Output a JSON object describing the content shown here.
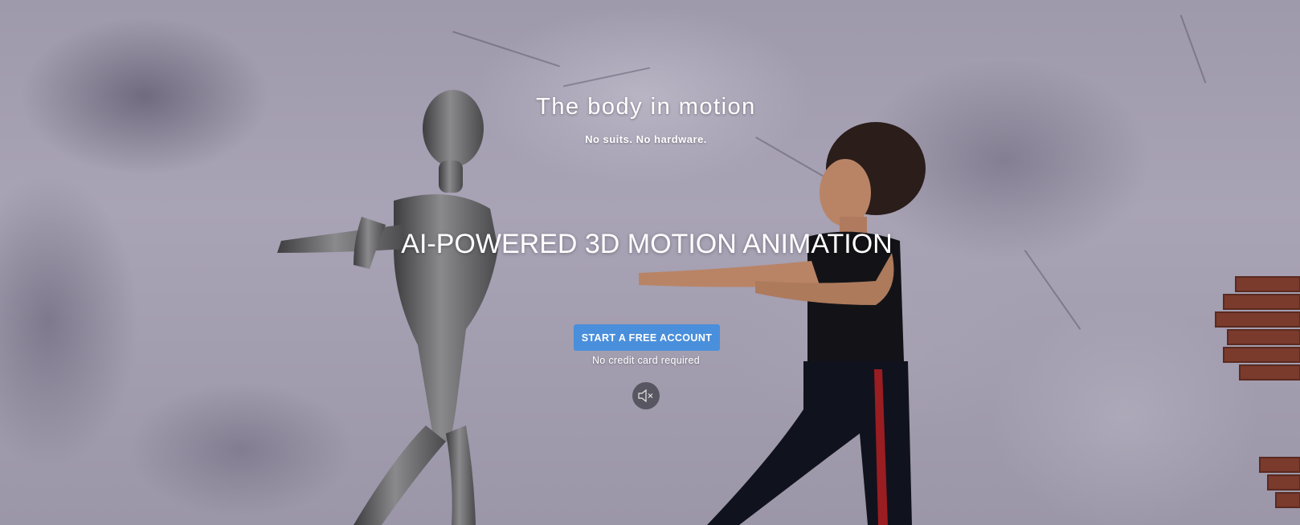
{
  "hero": {
    "title": "The body in motion",
    "subtitle": "No suits. No hardware.",
    "headline": "AI-POWERED 3D MOTION ANIMATION",
    "cta_label": "START A FREE ACCOUNT",
    "cta_note": "No credit card required",
    "mute_icon": "speaker-muted-icon"
  },
  "colors": {
    "cta_background": "#4a8fdb",
    "text": "#ffffff",
    "wall": "#a39fb0"
  }
}
